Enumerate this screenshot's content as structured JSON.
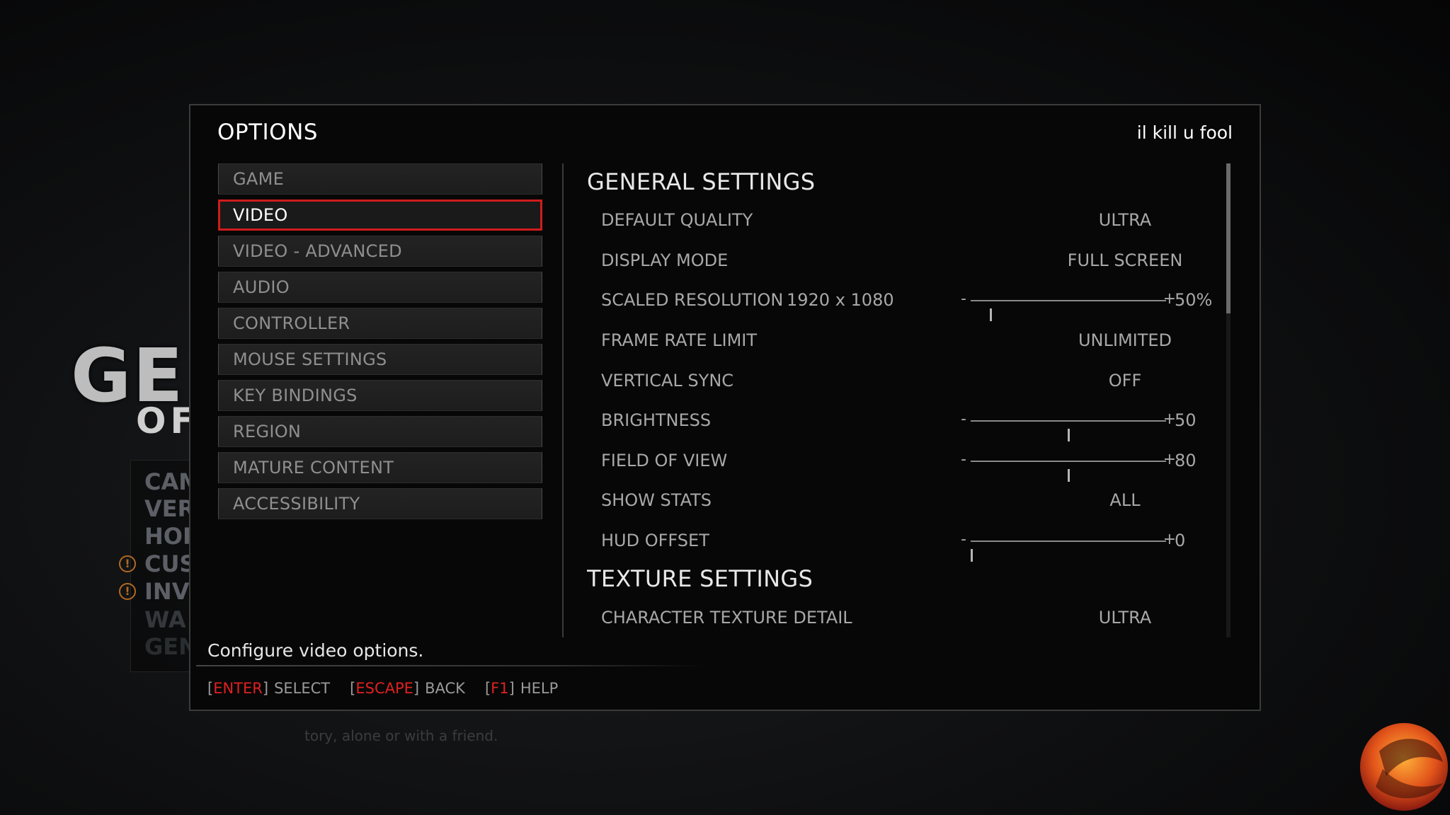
{
  "background": {
    "logo_text": "GE",
    "logo_sub": "OF",
    "menu_items": [
      "CAM",
      "VERS",
      "HOR",
      "CUS",
      "INV",
      "WA",
      "GEN"
    ],
    "caption": "tory, alone or with a friend."
  },
  "panel": {
    "title": "OPTIONS",
    "username": "il kill u fool"
  },
  "nav": {
    "items": [
      {
        "label": "GAME",
        "active": false
      },
      {
        "label": "VIDEO",
        "active": true
      },
      {
        "label": "VIDEO - ADVANCED",
        "active": false
      },
      {
        "label": "AUDIO",
        "active": false
      },
      {
        "label": "CONTROLLER",
        "active": false
      },
      {
        "label": "MOUSE SETTINGS",
        "active": false
      },
      {
        "label": "KEY BINDINGS",
        "active": false
      },
      {
        "label": "REGION",
        "active": false
      },
      {
        "label": "MATURE CONTENT",
        "active": false
      },
      {
        "label": "ACCESSIBILITY",
        "active": false
      }
    ]
  },
  "settings": {
    "general_title": "GENERAL SETTINGS",
    "default_quality": {
      "label": "DEFAULT QUALITY",
      "value": "ULTRA"
    },
    "display_mode": {
      "label": "DISPLAY MODE",
      "value": "FULL SCREEN"
    },
    "scaled_resolution": {
      "label": "SCALED RESOLUTION",
      "resolution": "1920 x 1080",
      "value": "50%",
      "level": 0.1
    },
    "frame_rate_limit": {
      "label": "FRAME RATE LIMIT",
      "value": "UNLIMITED"
    },
    "vertical_sync": {
      "label": "VERTICAL SYNC",
      "value": "OFF"
    },
    "brightness": {
      "label": "BRIGHTNESS",
      "value": "50",
      "level": 0.5
    },
    "field_of_view": {
      "label": "FIELD OF VIEW",
      "value": "80",
      "level": 0.5
    },
    "show_stats": {
      "label": "SHOW STATS",
      "value": "ALL"
    },
    "hud_offset": {
      "label": "HUD OFFSET",
      "value": "0",
      "level": 0.0
    },
    "texture_title": "TEXTURE SETTINGS",
    "character_texture_detail": {
      "label": "CHARACTER TEXTURE DETAIL",
      "value": "ULTRA"
    },
    "minus": "-",
    "plus": "+"
  },
  "footer": {
    "description": "Configure video options.",
    "hints": [
      {
        "key": "ENTER",
        "action": "SELECT"
      },
      {
        "key": "ESCAPE",
        "action": "BACK"
      },
      {
        "key": "F1",
        "action": "HELP"
      }
    ]
  },
  "colors": {
    "accent_red": "#d01c1c",
    "key_red": "#e02020",
    "panel_bg": "#070707"
  }
}
